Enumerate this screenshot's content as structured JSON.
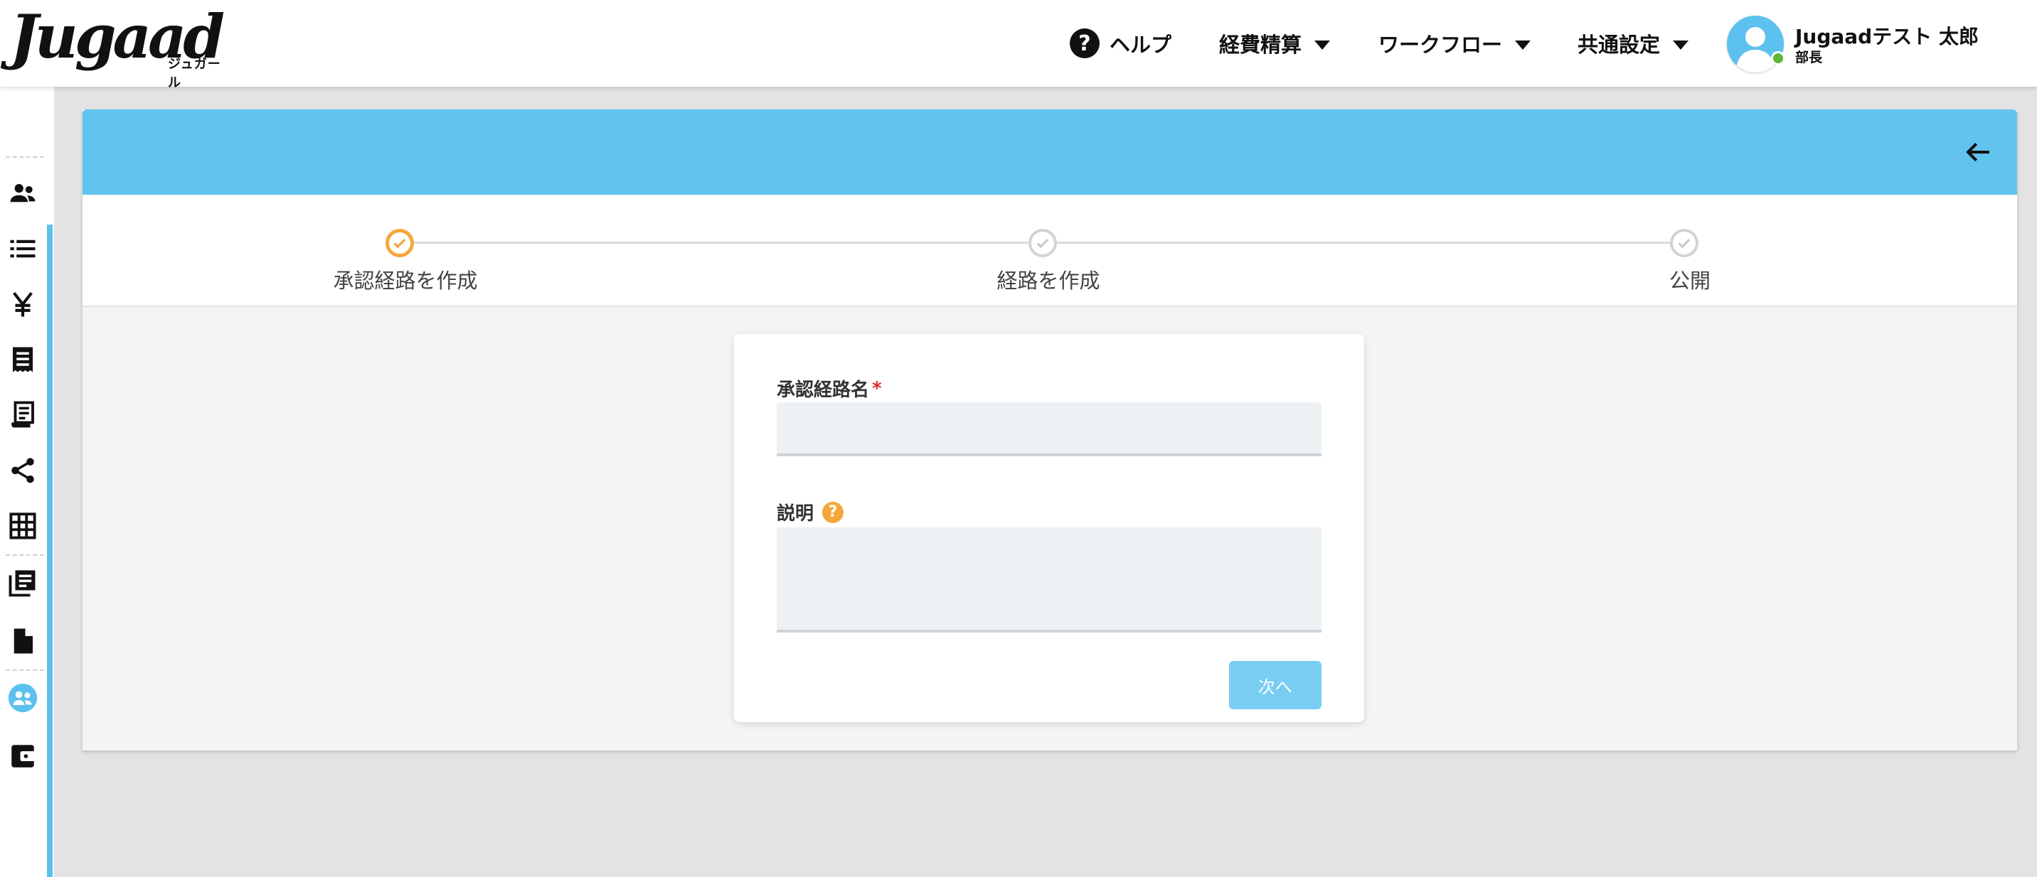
{
  "app": {
    "logo_text": "Jugaad",
    "logo_sub": "ジュガール"
  },
  "header": {
    "help_label": "ヘルプ",
    "menu": [
      {
        "label": "経費精算"
      },
      {
        "label": "ワークフロー"
      },
      {
        "label": "共通設定"
      }
    ],
    "user": {
      "name": "Jugaadテスト 太郎",
      "role": "部長"
    }
  },
  "sidebar": {
    "icons": [
      "people-icon",
      "list-icon",
      "yen-icon",
      "receipt-icon",
      "invoice-icon",
      "share-icon",
      "grid-icon",
      "library-icon",
      "document-icon",
      "group-icon",
      "wallet-icon"
    ]
  },
  "stepper": {
    "steps": [
      {
        "label": "承認経路を作成",
        "state": "active"
      },
      {
        "label": "経路を作成",
        "state": "inactive"
      },
      {
        "label": "公開",
        "state": "inactive"
      }
    ]
  },
  "form": {
    "name_label": "承認経路名",
    "required_mark": "*",
    "name_value": "",
    "description_label": "説明",
    "description_value": "",
    "next_label": "次へ"
  },
  "colors": {
    "accent": "#62c3ef",
    "step_active": "#f4a83b",
    "required": "#e02a2a",
    "online": "#5db53a"
  }
}
